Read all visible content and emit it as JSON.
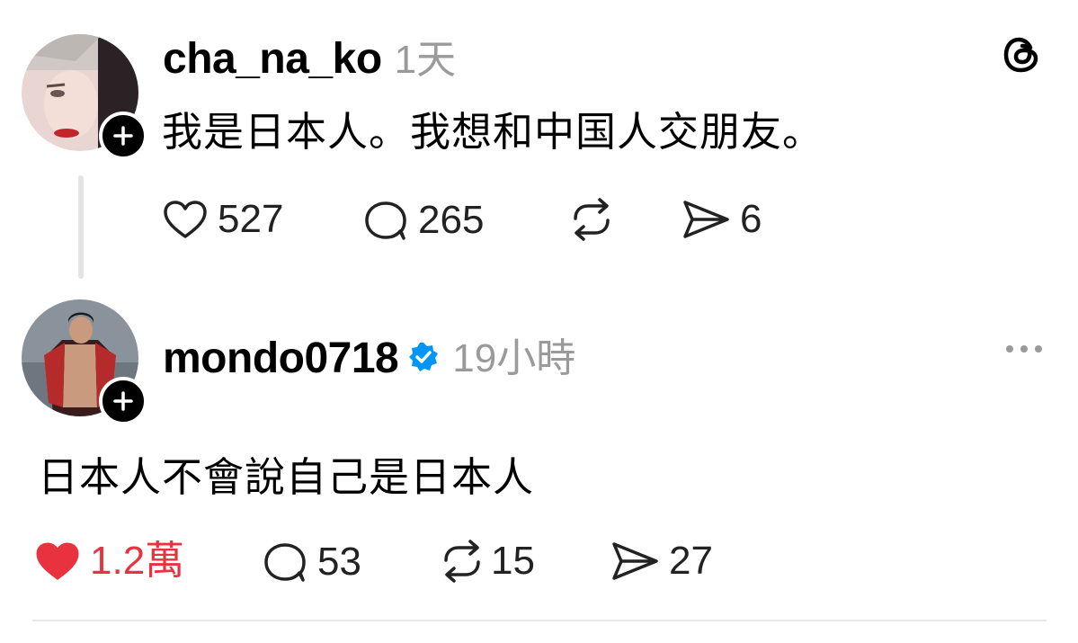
{
  "post": {
    "username": "cha_na_ko",
    "time": "1天",
    "text": "我是日本人。我想和中国人交朋友。",
    "likes": "527",
    "replies": "265",
    "shares": "6",
    "liked": false
  },
  "reply": {
    "username": "mondo0718",
    "verified": true,
    "time": "19小時",
    "text": "日本人不會說自己是日本人",
    "likes": "1.2萬",
    "replies": "53",
    "reposts": "15",
    "shares": "27",
    "liked": true
  },
  "icons": {
    "app_logo": "threads-logo-icon",
    "more": "more-dots-icon",
    "like": "heart-icon",
    "reply": "comment-icon",
    "repost": "repost-icon",
    "share": "send-icon",
    "follow": "plus-icon",
    "verified": "verified-badge-icon"
  },
  "colors": {
    "liked": "#e8323f",
    "verified": "#0095f6",
    "muted": "#9a9a9a"
  }
}
